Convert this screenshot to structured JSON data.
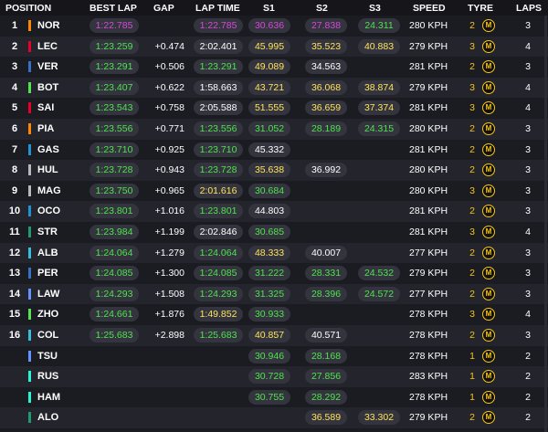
{
  "colors": {
    "purple": "#d44ad8",
    "green": "#4ee34e",
    "yellow": "#ffe45a",
    "white": "#ffffff",
    "tyre_medium": "#f5c518"
  },
  "header": {
    "position": "POSITION",
    "best_lap": "BEST LAP",
    "gap": "GAP",
    "lap_time": "LAP TIME",
    "s1": "S1",
    "s2": "S2",
    "s3": "S3",
    "speed": "SPEED",
    "tyre": "TYRE",
    "laps": "LAPS"
  },
  "rows": [
    {
      "pos": "1",
      "driver": "NOR",
      "team_color": "#ff8700",
      "best_lap": "1:22.785",
      "best_lap_color": "purple",
      "gap": "",
      "lap_time": "1:22.785",
      "lap_time_color": "purple",
      "s1": "30.636",
      "s1_color": "purple",
      "s2": "27.838",
      "s2_color": "purple",
      "s3": "24.311",
      "s3_color": "green",
      "speed": "280 KPH",
      "tyre_count": "2",
      "tyre": "M",
      "laps": "3"
    },
    {
      "pos": "2",
      "driver": "LEC",
      "team_color": "#e8002d",
      "best_lap": "1:23.259",
      "best_lap_color": "green",
      "gap": "+0.474",
      "lap_time": "2:02.401",
      "lap_time_color": "white",
      "s1": "45.995",
      "s1_color": "yellow",
      "s2": "35.523",
      "s2_color": "yellow",
      "s3": "40.883",
      "s3_color": "yellow",
      "speed": "279 KPH",
      "tyre_count": "3",
      "tyre": "M",
      "laps": "4"
    },
    {
      "pos": "3",
      "driver": "VER",
      "team_color": "#3671c6",
      "best_lap": "1:23.291",
      "best_lap_color": "green",
      "gap": "+0.506",
      "lap_time": "1:23.291",
      "lap_time_color": "green",
      "s1": "49.089",
      "s1_color": "yellow",
      "s2": "34.563",
      "s2_color": "white",
      "s3": "",
      "s3_color": "white",
      "speed": "281 KPH",
      "tyre_count": "2",
      "tyre": "M",
      "laps": "3"
    },
    {
      "pos": "4",
      "driver": "BOT",
      "team_color": "#52e252",
      "best_lap": "1:23.407",
      "best_lap_color": "green",
      "gap": "+0.622",
      "lap_time": "1:58.663",
      "lap_time_color": "white",
      "s1": "43.721",
      "s1_color": "yellow",
      "s2": "36.068",
      "s2_color": "yellow",
      "s3": "38.874",
      "s3_color": "yellow",
      "speed": "279 KPH",
      "tyre_count": "3",
      "tyre": "M",
      "laps": "4"
    },
    {
      "pos": "5",
      "driver": "SAI",
      "team_color": "#e8002d",
      "best_lap": "1:23.543",
      "best_lap_color": "green",
      "gap": "+0.758",
      "lap_time": "2:05.588",
      "lap_time_color": "white",
      "s1": "51.555",
      "s1_color": "yellow",
      "s2": "36.659",
      "s2_color": "yellow",
      "s3": "37.374",
      "s3_color": "yellow",
      "speed": "281 KPH",
      "tyre_count": "3",
      "tyre": "M",
      "laps": "4"
    },
    {
      "pos": "6",
      "driver": "PIA",
      "team_color": "#ff8700",
      "best_lap": "1:23.556",
      "best_lap_color": "green",
      "gap": "+0.771",
      "lap_time": "1:23.556",
      "lap_time_color": "green",
      "s1": "31.052",
      "s1_color": "green",
      "s2": "28.189",
      "s2_color": "green",
      "s3": "24.315",
      "s3_color": "green",
      "speed": "280 KPH",
      "tyre_count": "2",
      "tyre": "M",
      "laps": "3"
    },
    {
      "pos": "7",
      "driver": "GAS",
      "team_color": "#2293d1",
      "best_lap": "1:23.710",
      "best_lap_color": "green",
      "gap": "+0.925",
      "lap_time": "1:23.710",
      "lap_time_color": "green",
      "s1": "45.332",
      "s1_color": "white",
      "s2": "",
      "s2_color": "white",
      "s3": "",
      "s3_color": "white",
      "speed": "281 KPH",
      "tyre_count": "2",
      "tyre": "M",
      "laps": "3"
    },
    {
      "pos": "8",
      "driver": "HUL",
      "team_color": "#b6babd",
      "best_lap": "1:23.728",
      "best_lap_color": "green",
      "gap": "+0.943",
      "lap_time": "1:23.728",
      "lap_time_color": "green",
      "s1": "35.638",
      "s1_color": "yellow",
      "s2": "36.992",
      "s2_color": "white",
      "s3": "",
      "s3_color": "white",
      "speed": "280 KPH",
      "tyre_count": "2",
      "tyre": "M",
      "laps": "3"
    },
    {
      "pos": "9",
      "driver": "MAG",
      "team_color": "#b6babd",
      "best_lap": "1:23.750",
      "best_lap_color": "green",
      "gap": "+0.965",
      "lap_time": "2:01.616",
      "lap_time_color": "yellow",
      "s1": "30.684",
      "s1_color": "green",
      "s2": "",
      "s2_color": "white",
      "s3": "",
      "s3_color": "white",
      "speed": "280 KPH",
      "tyre_count": "3",
      "tyre": "M",
      "laps": "3"
    },
    {
      "pos": "10",
      "driver": "OCO",
      "team_color": "#2293d1",
      "best_lap": "1:23.801",
      "best_lap_color": "green",
      "gap": "+1.016",
      "lap_time": "1:23.801",
      "lap_time_color": "green",
      "s1": "44.803",
      "s1_color": "white",
      "s2": "",
      "s2_color": "white",
      "s3": "",
      "s3_color": "white",
      "speed": "281 KPH",
      "tyre_count": "2",
      "tyre": "M",
      "laps": "3"
    },
    {
      "pos": "11",
      "driver": "STR",
      "team_color": "#229971",
      "best_lap": "1:23.984",
      "best_lap_color": "green",
      "gap": "+1.199",
      "lap_time": "2:02.846",
      "lap_time_color": "white",
      "s1": "30.685",
      "s1_color": "green",
      "s2": "",
      "s2_color": "white",
      "s3": "",
      "s3_color": "white",
      "speed": "281 KPH",
      "tyre_count": "3",
      "tyre": "M",
      "laps": "4"
    },
    {
      "pos": "12",
      "driver": "ALB",
      "team_color": "#37bedd",
      "best_lap": "1:24.064",
      "best_lap_color": "green",
      "gap": "+1.279",
      "lap_time": "1:24.064",
      "lap_time_color": "green",
      "s1": "48.333",
      "s1_color": "yellow",
      "s2": "40.007",
      "s2_color": "white",
      "s3": "",
      "s3_color": "white",
      "speed": "277 KPH",
      "tyre_count": "2",
      "tyre": "M",
      "laps": "3"
    },
    {
      "pos": "13",
      "driver": "PER",
      "team_color": "#3671c6",
      "best_lap": "1:24.085",
      "best_lap_color": "green",
      "gap": "+1.300",
      "lap_time": "1:24.085",
      "lap_time_color": "green",
      "s1": "31.222",
      "s1_color": "green",
      "s2": "28.331",
      "s2_color": "green",
      "s3": "24.532",
      "s3_color": "green",
      "speed": "279 KPH",
      "tyre_count": "2",
      "tyre": "M",
      "laps": "3"
    },
    {
      "pos": "14",
      "driver": "LAW",
      "team_color": "#6692ff",
      "best_lap": "1:24.293",
      "best_lap_color": "green",
      "gap": "+1.508",
      "lap_time": "1:24.293",
      "lap_time_color": "green",
      "s1": "31.325",
      "s1_color": "green",
      "s2": "28.396",
      "s2_color": "green",
      "s3": "24.572",
      "s3_color": "green",
      "speed": "277 KPH",
      "tyre_count": "2",
      "tyre": "M",
      "laps": "3"
    },
    {
      "pos": "15",
      "driver": "ZHO",
      "team_color": "#52e252",
      "best_lap": "1:24.661",
      "best_lap_color": "green",
      "gap": "+1.876",
      "lap_time": "1:49.852",
      "lap_time_color": "yellow",
      "s1": "30.933",
      "s1_color": "green",
      "s2": "",
      "s2_color": "white",
      "s3": "",
      "s3_color": "white",
      "speed": "278 KPH",
      "tyre_count": "3",
      "tyre": "M",
      "laps": "4"
    },
    {
      "pos": "16",
      "driver": "COL",
      "team_color": "#37bedd",
      "best_lap": "1:25.683",
      "best_lap_color": "green",
      "gap": "+2.898",
      "lap_time": "1:25.683",
      "lap_time_color": "green",
      "s1": "40.857",
      "s1_color": "yellow",
      "s2": "40.571",
      "s2_color": "white",
      "s3": "",
      "s3_color": "white",
      "speed": "278 KPH",
      "tyre_count": "2",
      "tyre": "M",
      "laps": "3"
    },
    {
      "pos": "",
      "driver": "TSU",
      "team_color": "#6692ff",
      "best_lap": "",
      "best_lap_color": "white",
      "gap": "",
      "lap_time": "",
      "lap_time_color": "white",
      "s1": "30.946",
      "s1_color": "green",
      "s2": "28.168",
      "s2_color": "green",
      "s3": "",
      "s3_color": "white",
      "speed": "278 KPH",
      "tyre_count": "1",
      "tyre": "M",
      "laps": "2"
    },
    {
      "pos": "",
      "driver": "RUS",
      "team_color": "#27f4d2",
      "best_lap": "",
      "best_lap_color": "white",
      "gap": "",
      "lap_time": "",
      "lap_time_color": "white",
      "s1": "30.728",
      "s1_color": "green",
      "s2": "27.856",
      "s2_color": "green",
      "s3": "",
      "s3_color": "white",
      "speed": "283 KPH",
      "tyre_count": "1",
      "tyre": "M",
      "laps": "2"
    },
    {
      "pos": "",
      "driver": "HAM",
      "team_color": "#27f4d2",
      "best_lap": "",
      "best_lap_color": "white",
      "gap": "",
      "lap_time": "",
      "lap_time_color": "white",
      "s1": "30.755",
      "s1_color": "green",
      "s2": "28.292",
      "s2_color": "green",
      "s3": "",
      "s3_color": "white",
      "speed": "278 KPH",
      "tyre_count": "1",
      "tyre": "M",
      "laps": "2"
    },
    {
      "pos": "",
      "driver": "ALO",
      "team_color": "#229971",
      "best_lap": "",
      "best_lap_color": "white",
      "gap": "",
      "lap_time": "",
      "lap_time_color": "white",
      "s1": "",
      "s1_color": "white",
      "s2": "36.589",
      "s2_color": "yellow",
      "s3": "33.302",
      "s3_color": "yellow",
      "speed": "279 KPH",
      "tyre_count": "2",
      "tyre": "M",
      "laps": "2"
    }
  ]
}
